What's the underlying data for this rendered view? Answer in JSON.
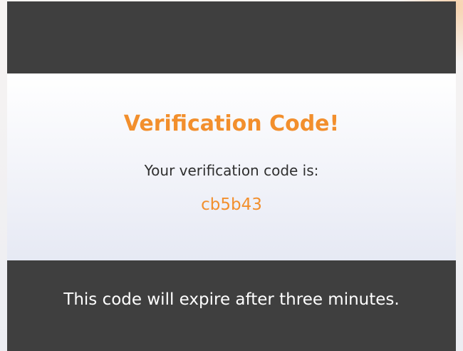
{
  "email": {
    "title": "Verification Code!",
    "intro": "Your verification code is:",
    "code": "cb5b43",
    "footer": "This code will expire after three minutes."
  },
  "colors": {
    "accent": "#F28F2D",
    "bar": "#3F3F3F",
    "text": "#2F2F2F",
    "footer_text": "#FFFFFF"
  }
}
